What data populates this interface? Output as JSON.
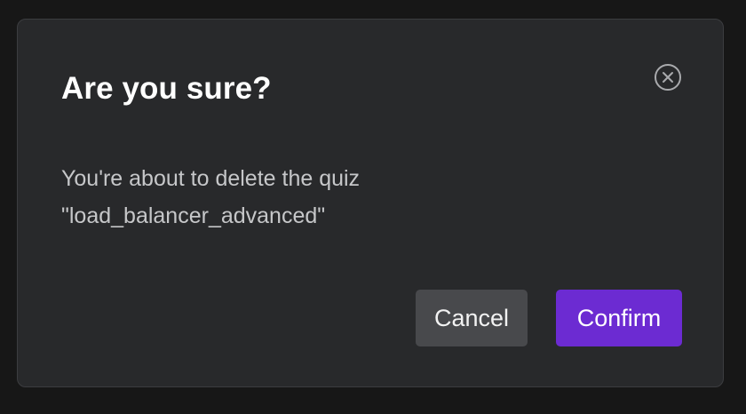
{
  "dialog": {
    "title": "Are you sure?",
    "message_line1": "You're about to delete the quiz",
    "message_line2": "\"load_balancer_advanced\"",
    "close_icon": "close-circle-icon",
    "cancel_label": "Cancel",
    "confirm_label": "Confirm"
  },
  "colors": {
    "background": "#171717",
    "dialog": "#28292b",
    "cancel": "#48494c",
    "confirm": "#6c2bd2"
  }
}
